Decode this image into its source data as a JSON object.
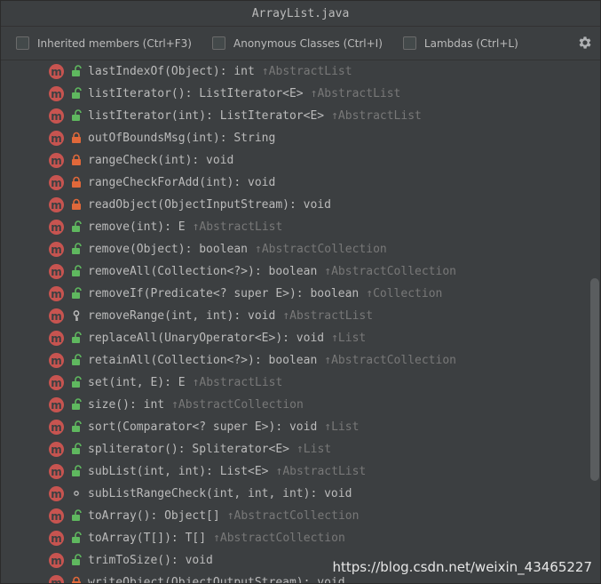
{
  "window": {
    "title": "ArrayList.java"
  },
  "toolbar": {
    "options": [
      {
        "label": "Inherited members (Ctrl+F3)",
        "checked": false
      },
      {
        "label": "Anonymous Classes (Ctrl+I)",
        "checked": false
      },
      {
        "label": "Lambdas (Ctrl+L)",
        "checked": false
      }
    ],
    "settings_icon": "gear-icon"
  },
  "members": [
    {
      "signature": "lastIndexOf(Object): int",
      "inherited": "↑AbstractList",
      "visibility": "public"
    },
    {
      "signature": "listIterator(): ListIterator<E>",
      "inherited": "↑AbstractList",
      "visibility": "public"
    },
    {
      "signature": "listIterator(int): ListIterator<E>",
      "inherited": "↑AbstractList",
      "visibility": "public"
    },
    {
      "signature": "outOfBoundsMsg(int): String",
      "inherited": "",
      "visibility": "private"
    },
    {
      "signature": "rangeCheck(int): void",
      "inherited": "",
      "visibility": "private"
    },
    {
      "signature": "rangeCheckForAdd(int): void",
      "inherited": "",
      "visibility": "private"
    },
    {
      "signature": "readObject(ObjectInputStream): void",
      "inherited": "",
      "visibility": "private"
    },
    {
      "signature": "remove(int): E",
      "inherited": "↑AbstractList",
      "visibility": "public"
    },
    {
      "signature": "remove(Object): boolean",
      "inherited": "↑AbstractCollection",
      "visibility": "public"
    },
    {
      "signature": "removeAll(Collection<?>): boolean",
      "inherited": "↑AbstractCollection",
      "visibility": "public"
    },
    {
      "signature": "removeIf(Predicate<? super E>): boolean",
      "inherited": "↑Collection",
      "visibility": "public"
    },
    {
      "signature": "removeRange(int, int): void",
      "inherited": "↑AbstractList",
      "visibility": "protected"
    },
    {
      "signature": "replaceAll(UnaryOperator<E>): void",
      "inherited": "↑List",
      "visibility": "public"
    },
    {
      "signature": "retainAll(Collection<?>): boolean",
      "inherited": "↑AbstractCollection",
      "visibility": "public"
    },
    {
      "signature": "set(int, E): E",
      "inherited": "↑AbstractList",
      "visibility": "public"
    },
    {
      "signature": "size(): int",
      "inherited": "↑AbstractCollection",
      "visibility": "public"
    },
    {
      "signature": "sort(Comparator<? super E>): void",
      "inherited": "↑List",
      "visibility": "public"
    },
    {
      "signature": "spliterator(): Spliterator<E>",
      "inherited": "↑List",
      "visibility": "public"
    },
    {
      "signature": "subList(int, int): List<E>",
      "inherited": "↑AbstractList",
      "visibility": "public"
    },
    {
      "signature": "subListRangeCheck(int, int, int): void",
      "inherited": "",
      "visibility": "package"
    },
    {
      "signature": "toArray(): Object[]",
      "inherited": "↑AbstractCollection",
      "visibility": "public"
    },
    {
      "signature": "toArray(T[]): T[]",
      "inherited": "↑AbstractCollection",
      "visibility": "public"
    },
    {
      "signature": "trimToSize(): void",
      "inherited": "",
      "visibility": "public"
    },
    {
      "signature": "writeObject(ObjectOutputStream): void",
      "inherited": "",
      "visibility": "private"
    }
  ],
  "method_icon_letter": "m",
  "colors": {
    "method_icon": "#c75450",
    "public_lock": "#5fb85f",
    "private_lock": "#e0683a",
    "protected_key": "#bbbbbb",
    "inherited_text": "#787878"
  },
  "watermark": "https://blog.csdn.net/weixin_43465227"
}
